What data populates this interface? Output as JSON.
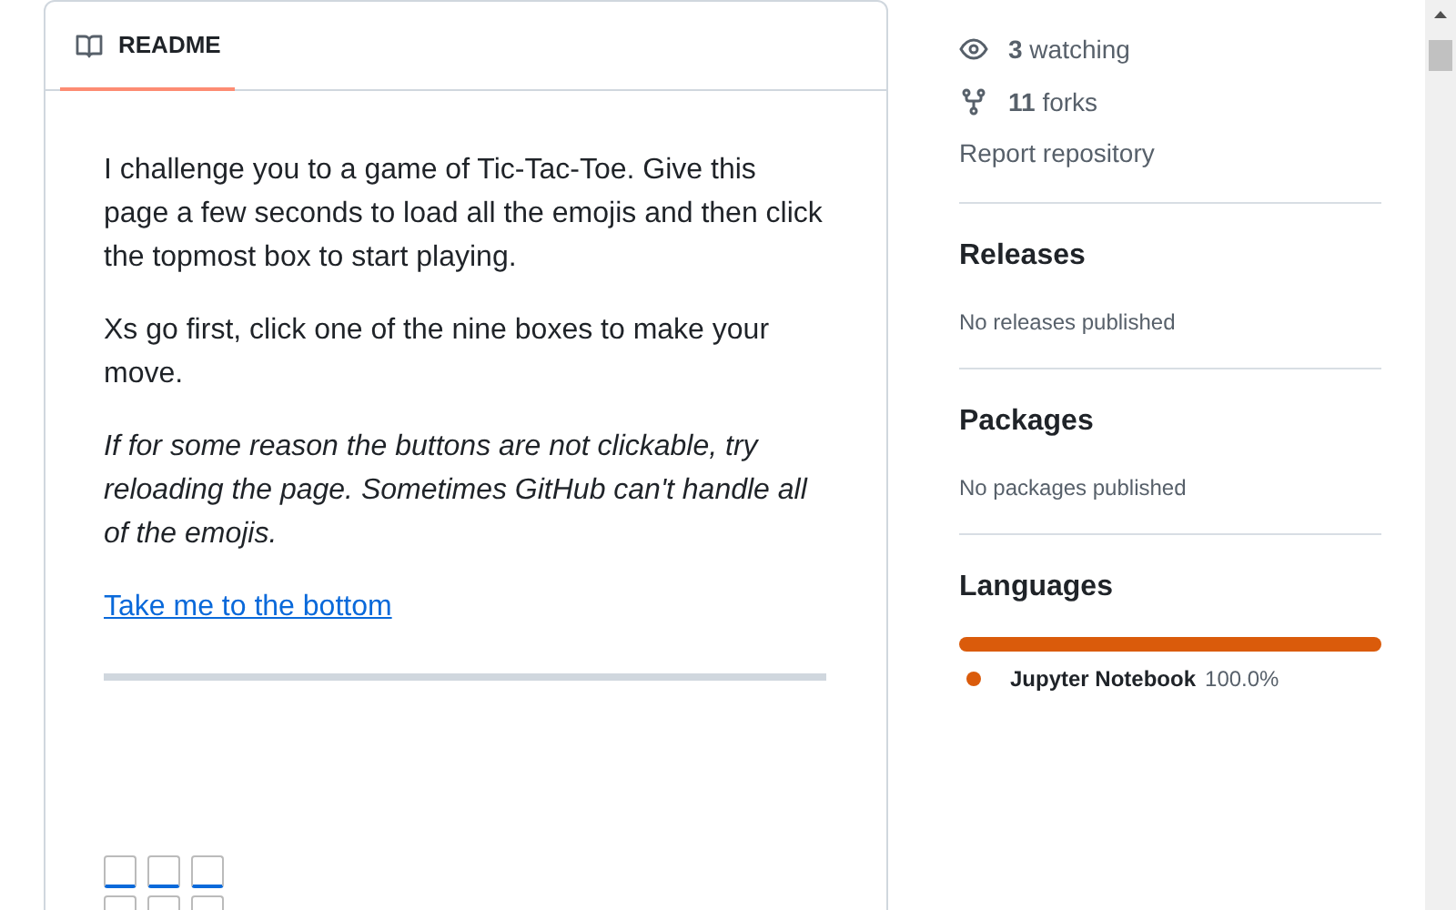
{
  "readme": {
    "tab": {
      "label": "README",
      "selected": true
    },
    "paragraphs": [
      {
        "kind": "plain",
        "text": "I challenge you to a game of Tic-Tac-Toe. Give this page a few seconds to load all the emojis and then click the topmost box to start playing."
      },
      {
        "kind": "plain",
        "text": "Xs go first, click one of the nine boxes to make your move."
      },
      {
        "kind": "italic",
        "text": "If for some reason the buttons are not clickable, try reloading the page. Sometimes GitHub can't handle all of the emojis."
      }
    ],
    "link": "Take me to the bottom",
    "board": [
      [
        {
          "kind": "empty"
        },
        {
          "kind": "empty"
        },
        {
          "kind": "empty"
        }
      ],
      [
        {
          "kind": "empty"
        },
        {
          "kind": "empty"
        },
        {
          "kind": "empty"
        }
      ]
    ]
  },
  "sidebar": {
    "stats": [
      {
        "kind": "watching",
        "text": "3 watching"
      },
      {
        "kind": "forks",
        "text": "11 forks"
      }
    ],
    "report": "Report repository",
    "sections": [
      {
        "title": "Releases",
        "note": "No releases published"
      },
      {
        "title": "Packages",
        "note": "No packages published"
      }
    ],
    "languages": {
      "title": "Languages",
      "items": [
        {
          "name": "Jupyter Notebook",
          "percent": "100.0%",
          "level": 1.0,
          "color": "#da5b0b"
        }
      ]
    }
  }
}
